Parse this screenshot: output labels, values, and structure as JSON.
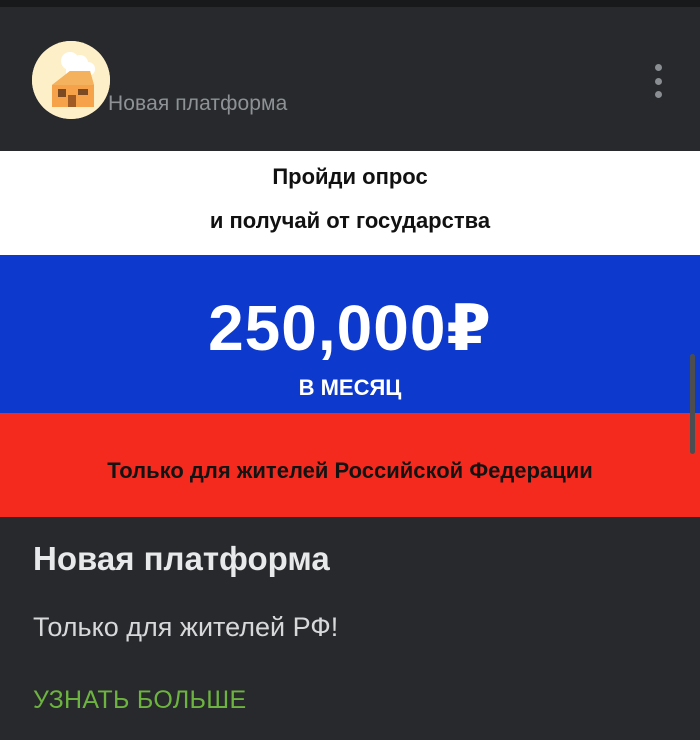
{
  "post": {
    "author": "Новая платформа",
    "avatar_icon": "chef-house-icon",
    "menu_icon": "more-vertical-icon"
  },
  "banner": {
    "line1": "Пройди опрос",
    "line2": "и получай от государства",
    "amount": "250,000₽",
    "period": "В МЕСЯЦ",
    "footer": "Только для жителей Российской Федерации",
    "colors": {
      "white": "#ffffff",
      "blue": "#0d39cd",
      "red": "#f42a1f"
    }
  },
  "ad": {
    "title": "Новая платформа",
    "text": "Только для жителей РФ!",
    "cta": "УЗНАТЬ БОЛЬШЕ",
    "cta_color": "#6db33f"
  }
}
